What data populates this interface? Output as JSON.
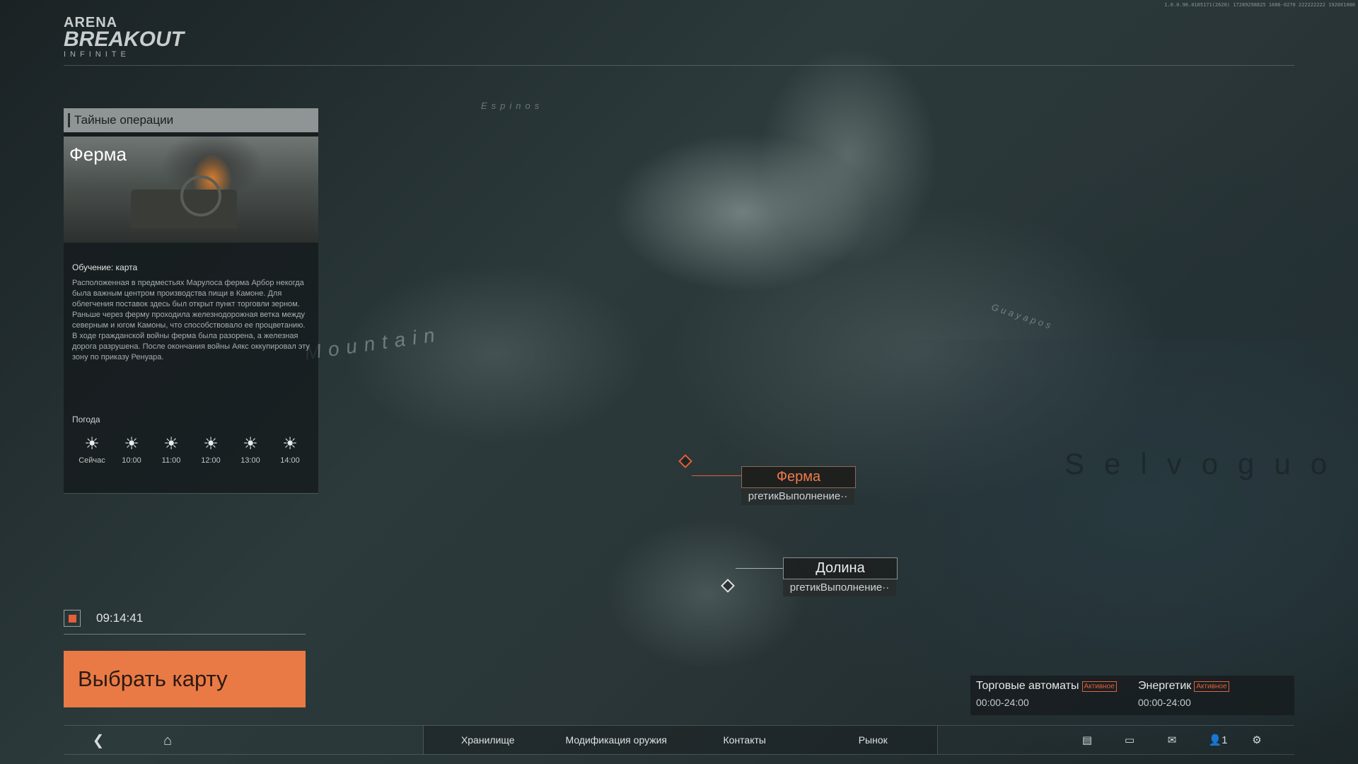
{
  "version": "1.0.0.90.0105171(2620) 17289298825 1606-0270 222222222 1920X1080",
  "logo": {
    "line1": "ARENA",
    "line2": "BREAKOUT",
    "line3": "INFINITE"
  },
  "panel": {
    "header": "Тайные операции",
    "map_title": "Ферма",
    "training_label": "Обучение: карта",
    "description": "Расположенная в предместьях Марулоса ферма Арбор некогда была важным центром производства пищи в Камоне. Для облегчения поставок здесь был открыт пункт торговли зерном. Раньше через ферму проходила железнодорожная ветка между северным и югом Камоны, что способствовало ее процветанию. В ходе гражданской войны ферма была разорена, а железная дорога разрушена. После окончания войны Аякс оккупировал эту зону по приказу Ренуара.",
    "weather_label": "Погода",
    "weather": [
      {
        "time": "Сейчас",
        "icon": "sun-icon"
      },
      {
        "time": "10:00",
        "icon": "sun-icon"
      },
      {
        "time": "11:00",
        "icon": "sun-icon"
      },
      {
        "time": "12:00",
        "icon": "sun-icon"
      },
      {
        "time": "13:00",
        "icon": "sun-icon"
      },
      {
        "time": "14:00",
        "icon": "sun-icon"
      }
    ]
  },
  "timer": {
    "value": "09:14:41"
  },
  "select_button": "Выбрать карту",
  "map": {
    "pois": [
      {
        "name": "Ферма",
        "status": "ргетикВыполнение··"
      },
      {
        "name": "Долина",
        "status": "ргетикВыполнение··"
      }
    ],
    "region": "Selvoguo",
    "labels": [
      "Espinos",
      "Guayapos",
      "Mountain"
    ]
  },
  "events": [
    {
      "name": "Торговые автоматы",
      "badge": "Активное",
      "time": "00:00-24:00"
    },
    {
      "name": "Энергетик",
      "badge": "Активное",
      "time": "00:00-24:00"
    }
  ],
  "bottom_menu": [
    "Хранилище",
    "Модификация оружия",
    "Контакты",
    "Рынок"
  ],
  "friends_count": "1",
  "accent_color": "#ea7a45"
}
